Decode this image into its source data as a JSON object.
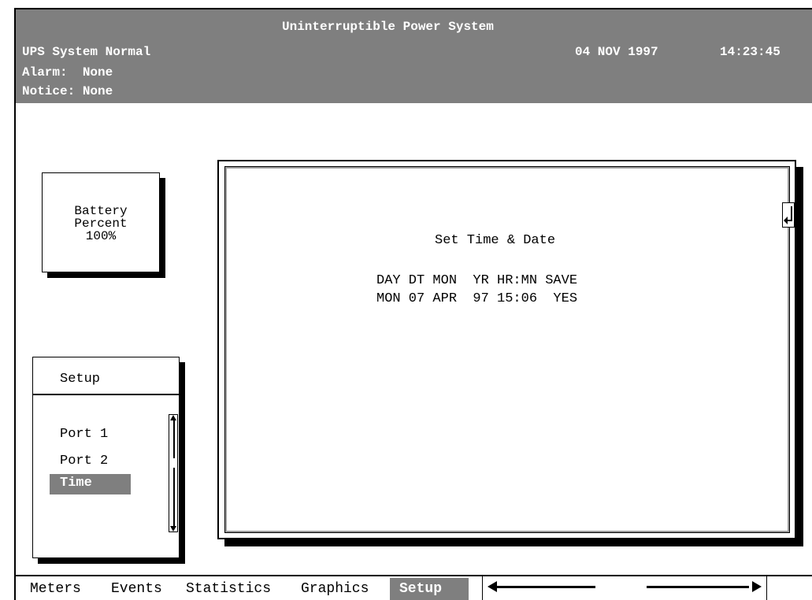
{
  "header": {
    "title": "Uninterruptible Power System",
    "status": "UPS System Normal",
    "alarm": "Alarm:  None",
    "notice": "Notice: None",
    "date": "04 NOV 1997",
    "time": "14:23:45"
  },
  "battery": {
    "line1": "Battery",
    "line2": "Percent",
    "line3": "100%",
    "percent": 100
  },
  "menu": {
    "title": "Setup",
    "items": [
      {
        "label": "Port 1",
        "selected": false
      },
      {
        "label": "Port 2",
        "selected": false
      },
      {
        "label": "Time",
        "selected": true
      }
    ]
  },
  "panel": {
    "title": "Set Time & Date",
    "header_row": "DAY DT MON  YR HR:MN SAVE",
    "value_row": "MON 07 APR  97 15:06  YES",
    "enter_icon": "enter-arrow-icon"
  },
  "tabs": {
    "items": [
      "Meters",
      "Events",
      "Statistics",
      "Graphics",
      "Setup"
    ],
    "active": "Setup"
  },
  "colors": {
    "header_bg": "#7f7f7f",
    "highlight_bg": "#7f7f7f",
    "text": "#000000",
    "background": "#ffffff"
  }
}
